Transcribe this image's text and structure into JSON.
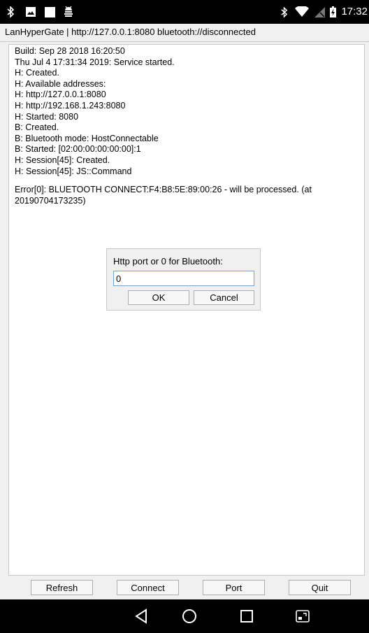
{
  "status_bar": {
    "time": "17:32",
    "icons": [
      "bluetooth-icon",
      "image-icon",
      "square-notification-icon",
      "android-debug-icon",
      "bluetooth-icon",
      "wifi-icon",
      "no-signal-icon",
      "battery-icon"
    ]
  },
  "window": {
    "title": "LanHyperGate | http://127.0.0.1:8080 bluetooth://disconnected"
  },
  "log": {
    "lines": [
      "Build: Sep 28 2018 16:20:50",
      "Thu Jul 4 17:31:34 2019: Service started.",
      "H: Created.",
      "H: Available addresses:",
      "H: http://127.0.0.1:8080",
      "H: http://192.168.1.243:8080",
      "H: Started: 8080",
      "B: Created.",
      "B: Bluetooth mode: HostConnectable",
      "B: Started: [02:00:00:00:00:00]:1",
      "H: Session[45]: Created.",
      "H: Session[45]: JS::Command"
    ],
    "error": "Error[0]: BLUETOOTH CONNECT:F4:B8:5E:89:00:26 - will be processed. (at 20190704173235)"
  },
  "dialog": {
    "label": "Http port or 0 for Bluetooth:",
    "input_value": "0",
    "ok_label": "OK",
    "cancel_label": "Cancel"
  },
  "buttons": {
    "refresh": "Refresh",
    "connect": "Connect",
    "port": "Port",
    "quit": "Quit"
  },
  "nav_bar": {
    "icons": [
      "back-icon",
      "home-icon",
      "recents-icon",
      "keyboard-toggle-icon"
    ]
  }
}
